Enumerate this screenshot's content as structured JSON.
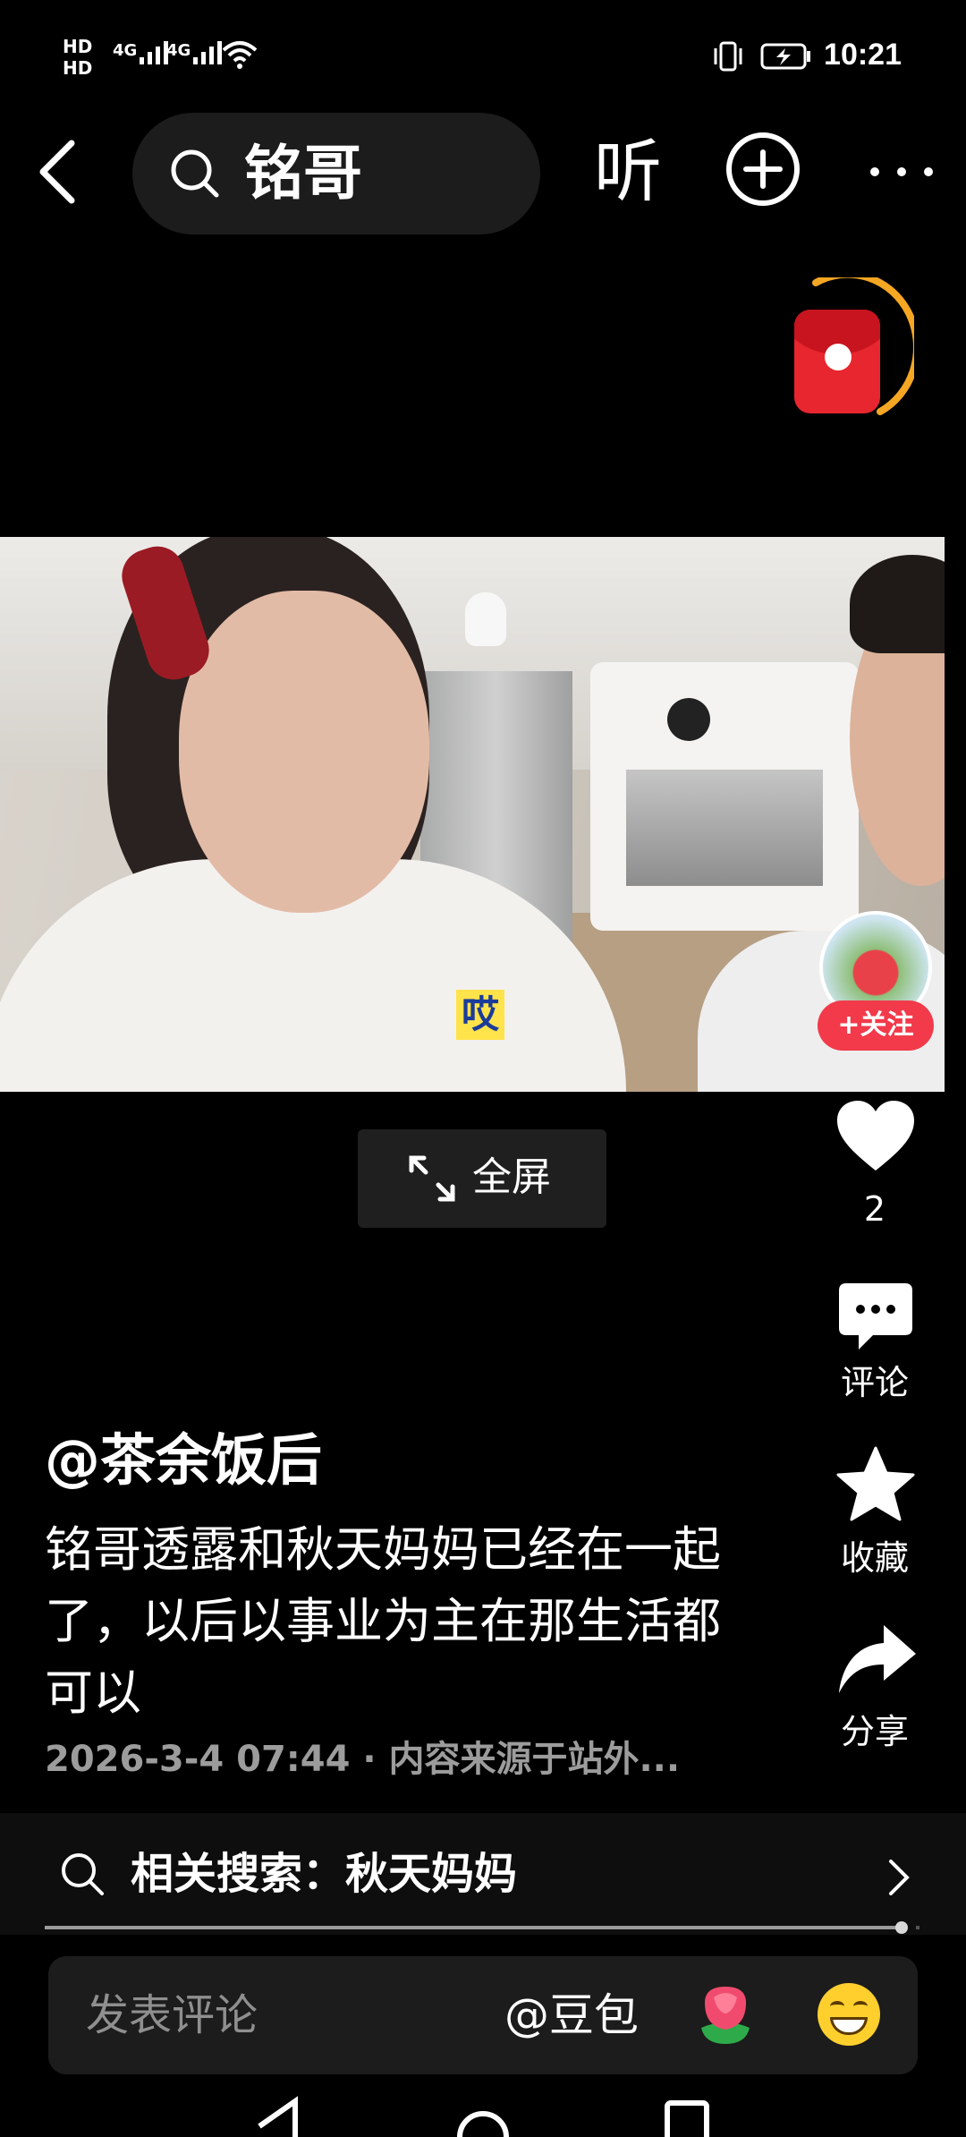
{
  "status_bar": {
    "hd1": "HD",
    "hd2": "HD",
    "sim1_net": "4G",
    "sim2_net": "4G",
    "time": "10:21",
    "icons": [
      "vibrate-icon",
      "battery-charging-icon",
      "wifi-icon",
      "signal-icon"
    ]
  },
  "top_bar": {
    "search_query": "铭哥",
    "listen_label": "听",
    "icons": [
      "back-icon",
      "search-icon",
      "plus-circle-icon",
      "more-icon"
    ]
  },
  "video": {
    "subtitle": "哎",
    "fullscreen_label": "全屏"
  },
  "rail": {
    "follow_label": "+关注",
    "like_count": "2",
    "comment_label": "评论",
    "collect_label": "收藏",
    "share_label": "分享"
  },
  "caption": {
    "author": "@茶余饭后",
    "description": "铭哥透露和秋天妈妈已经在一起了，以后以事业为主在那生活都可以",
    "meta": "2026-3-4 07:44 · 内容来源于站外..."
  },
  "related": {
    "text": "相关搜索：秋天妈妈",
    "progress": 0.98
  },
  "comment_bar": {
    "placeholder": "发表评论",
    "mention": "@豆包"
  },
  "colors": {
    "background": "#000000",
    "follow_red": "#f23a4b",
    "envelope_red": "#e8262f",
    "timer_orange": "#f5a623"
  }
}
